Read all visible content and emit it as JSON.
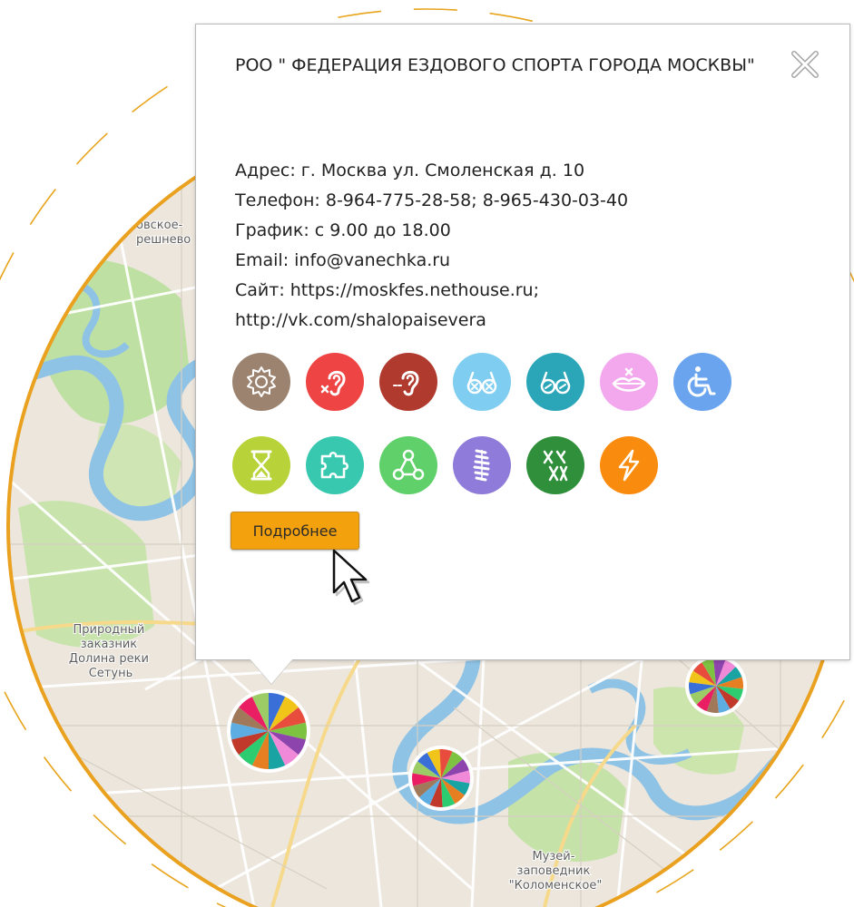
{
  "map": {
    "labels": [
      {
        "lines": [
          "овское-",
          "решнево"
        ]
      },
      {
        "lines": [
          "Природный",
          "заказник",
          "Долина реки",
          "Сетунь"
        ]
      },
      {
        "lines": [
          "Музей-",
          "заповедник",
          "\"Коломенское\""
        ]
      }
    ],
    "clusters": [
      {
        "name": "cluster-selected",
        "selected": true
      },
      {
        "name": "cluster-center",
        "selected": false
      },
      {
        "name": "cluster-east",
        "selected": false
      }
    ],
    "cluster_colors": [
      "#3a6fd8",
      "#f0c419",
      "#e84c3d",
      "#7ec242",
      "#8e44ad",
      "#f08ad8",
      "#1aa3a3",
      "#e67e22",
      "#2ecc71",
      "#c0392b",
      "#5dade2",
      "#a0785a",
      "#e91e63",
      "#9ccc65"
    ]
  },
  "popup": {
    "title": "РОО \" ФЕДЕРАЦИЯ ЕЗДОВОГО СПОРТА ГОРОДА МОСКВЫ\"",
    "address": "Адрес: г. Москва ул. Смоленская д. 10",
    "phone": "Телефон: 8-964-775-28-58; 8-965-430-03-40",
    "schedule": "График: с 9.00 до 18.00",
    "email": "Email: info@vanechka.ru",
    "site_line1": "Сайт: https://moskfes.nethouse.ru;",
    "site_line2": "http://vk.com/shalopaisevera",
    "more_button": "Подробнее",
    "icons_row1": [
      {
        "icon": "gear-icon",
        "color": "#9b8370"
      },
      {
        "icon": "ear-mute-icon",
        "color": "#ef4444"
      },
      {
        "icon": "ear-hearing-icon",
        "color": "#b03a2e"
      },
      {
        "icon": "glasses-blind-icon",
        "color": "#7fcdf0"
      },
      {
        "icon": "glasses-icon",
        "color": "#2aa6b8"
      },
      {
        "icon": "lips-icon",
        "color": "#f3a8ee"
      },
      {
        "icon": "wheelchair-icon",
        "color": "#6aa4ef"
      }
    ],
    "icons_row2": [
      {
        "icon": "hourglass-icon",
        "color": "#b8d33a"
      },
      {
        "icon": "puzzle-icon",
        "color": "#38c8b0"
      },
      {
        "icon": "network-icon",
        "color": "#5fd06a"
      },
      {
        "icon": "spine-icon",
        "color": "#8f7bd9"
      },
      {
        "icon": "chromosome-icon",
        "color": "#2f8f3a"
      },
      {
        "icon": "lightning-icon",
        "color": "#f98b0e"
      }
    ]
  }
}
